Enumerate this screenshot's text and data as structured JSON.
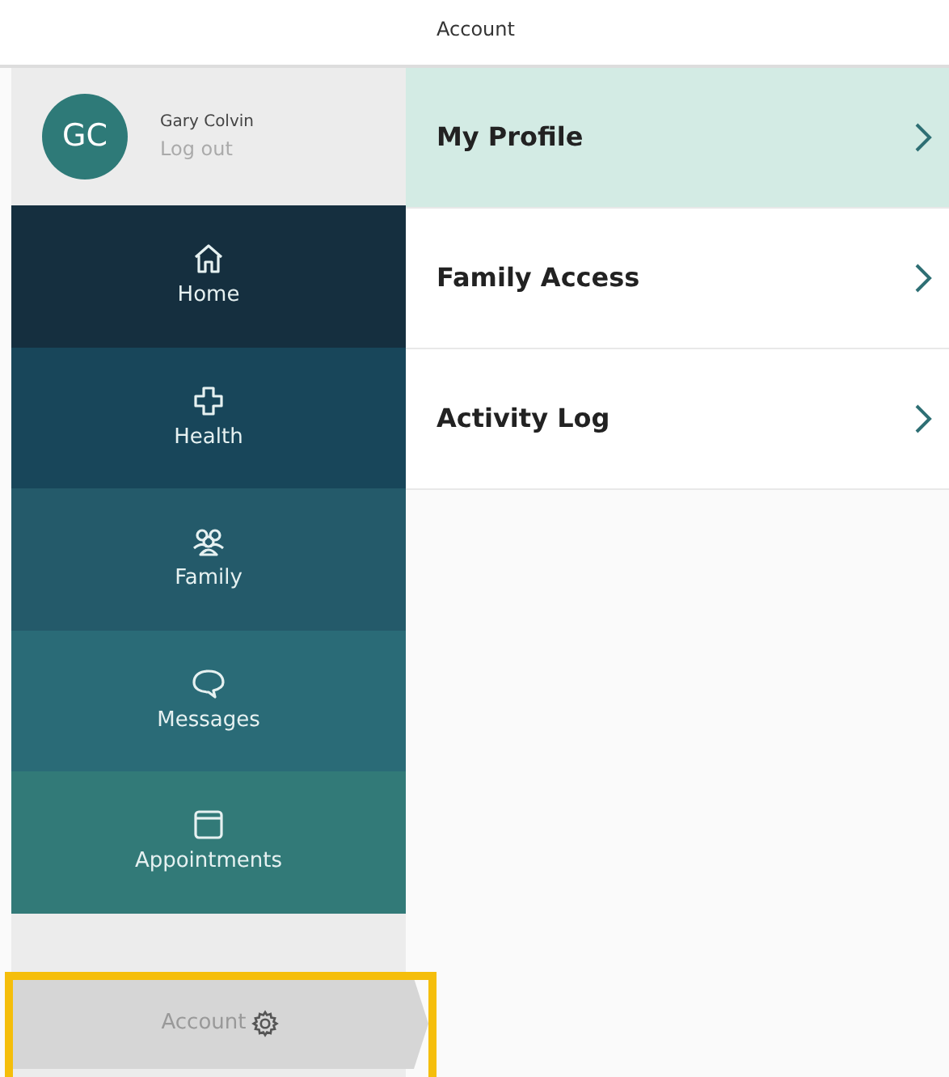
{
  "header": {
    "title": "Account"
  },
  "user": {
    "initials": "GC",
    "name": "Gary Colvin",
    "logout": "Log out"
  },
  "nav": [
    {
      "label": "Home",
      "color": "#152f3f"
    },
    {
      "label": "Health",
      "color": "#18465a"
    },
    {
      "label": "Family",
      "color": "#245a6a"
    },
    {
      "label": "Messages",
      "color": "#2a6b77"
    },
    {
      "label": "Appointments",
      "color": "#327a78"
    }
  ],
  "account_button": {
    "label": "Account",
    "highlighted": true
  },
  "menu": [
    {
      "label": "My Profile",
      "selected": true
    },
    {
      "label": "Family Access",
      "selected": false
    },
    {
      "label": "Activity Log",
      "selected": false
    }
  ]
}
